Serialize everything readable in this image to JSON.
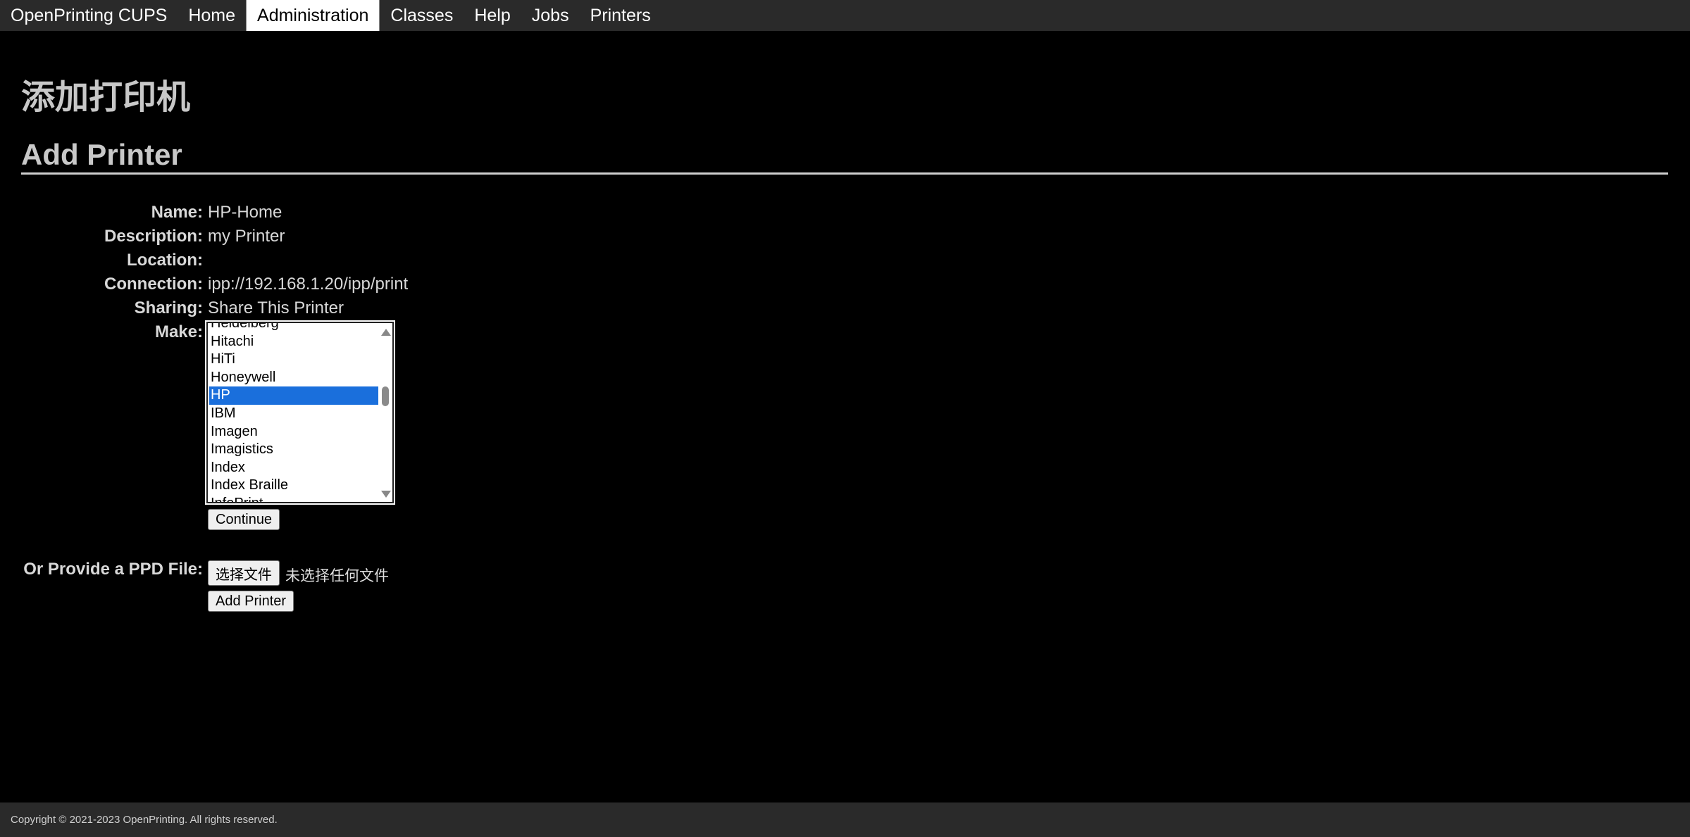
{
  "nav": {
    "items": [
      {
        "label": "OpenPrinting CUPS",
        "active": false
      },
      {
        "label": "Home",
        "active": false
      },
      {
        "label": "Administration",
        "active": true
      },
      {
        "label": "Classes",
        "active": false
      },
      {
        "label": "Help",
        "active": false
      },
      {
        "label": "Jobs",
        "active": false
      },
      {
        "label": "Printers",
        "active": false
      }
    ]
  },
  "page": {
    "title_cn": "添加打印机",
    "title_en": "Add Printer"
  },
  "form": {
    "name_label": "Name:",
    "name_value": "HP-Home",
    "description_label": "Description:",
    "description_value": "my Printer",
    "location_label": "Location:",
    "location_value": "",
    "connection_label": "Connection:",
    "connection_value": "ipp://192.168.1.20/ipp/print",
    "sharing_label": "Sharing:",
    "sharing_value": "Share This Printer",
    "make_label": "Make:",
    "make_options": [
      "Heidelberg",
      "Hitachi",
      "HiTi",
      "Honeywell",
      "HP",
      "IBM",
      "Imagen",
      "Imagistics",
      "Index",
      "Index Braille",
      "InfoPrint"
    ],
    "make_selected": "HP",
    "continue_label": "Continue",
    "ppd_label": "Or Provide a PPD File:",
    "choose_file_label": "选择文件",
    "no_file_text": "未选择任何文件",
    "add_printer_label": "Add Printer"
  },
  "footer": {
    "text": "Copyright © 2021-2023 OpenPrinting. All rights reserved."
  },
  "colors": {
    "background": "#000000",
    "nav_bg": "#2a2a2a",
    "selected": "#1a6fdc"
  }
}
